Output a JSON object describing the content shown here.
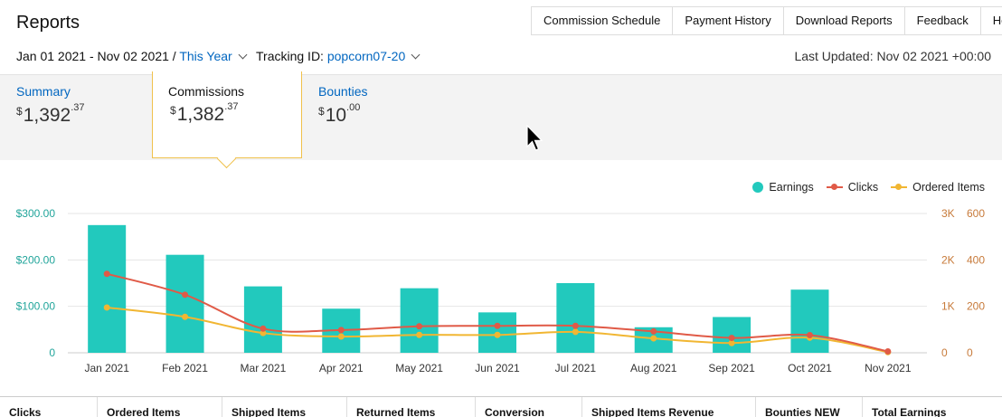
{
  "header": {
    "title": "Reports",
    "nav": [
      "Commission Schedule",
      "Payment History",
      "Download Reports",
      "Feedback",
      "Help"
    ]
  },
  "subbar": {
    "date_range": "Jan 01 2021 - Nov 02 2021",
    "separator": "/",
    "period": "This Year",
    "tracking_label": "Tracking ID:",
    "tracking_id": "popcorn07-20",
    "last_updated": "Last Updated: Nov 02 2021 +00:00"
  },
  "tabs": [
    {
      "label": "Summary",
      "currency": "$",
      "whole": "1,392",
      "cents": ".37"
    },
    {
      "label": "Commissions",
      "currency": "$",
      "whole": "1,382",
      "cents": ".37"
    },
    {
      "label": "Bounties",
      "currency": "$",
      "whole": "10",
      "cents": ".00"
    }
  ],
  "colors": {
    "earnings": "#22c9bd",
    "clicks": "#e05a47",
    "ordered": "#f1b632",
    "right_axis": "#c77a3a",
    "left_axis": "#22a59b",
    "accent": "#0066c0"
  },
  "chart_data": {
    "type": "bar",
    "categories": [
      "Jan 2021",
      "Feb 2021",
      "Mar 2021",
      "Apr 2021",
      "May 2021",
      "Jun 2021",
      "Jul 2021",
      "Aug 2021",
      "Sep 2021",
      "Oct 2021",
      "Nov 2021"
    ],
    "series": [
      {
        "name": "Earnings",
        "type": "bar",
        "axis": "left",
        "values": [
          275,
          211,
          143,
          95,
          139,
          87,
          150,
          55,
          77,
          136,
          0
        ]
      },
      {
        "name": "Clicks",
        "type": "line",
        "axis": "right-outer",
        "values": [
          1700,
          1250,
          520,
          490,
          570,
          580,
          580,
          460,
          320,
          380,
          30
        ]
      },
      {
        "name": "Ordered Items",
        "type": "line",
        "axis": "right-inner",
        "values": [
          195,
          155,
          85,
          70,
          77,
          77,
          90,
          62,
          42,
          65,
          3
        ]
      }
    ],
    "y_left": {
      "ticks": [
        "$300.00",
        "$200.00",
        "$100.00",
        "0"
      ],
      "range": [
        0,
        300
      ]
    },
    "y_right_outer": {
      "ticks": [
        "3K",
        "2K",
        "1K",
        "0"
      ],
      "range": [
        0,
        3000
      ]
    },
    "y_right_inner": {
      "ticks": [
        "600",
        "400",
        "200",
        "0"
      ],
      "range": [
        0,
        600
      ]
    },
    "legend": [
      "Earnings",
      "Clicks",
      "Ordered Items"
    ],
    "legend_position": "top-right",
    "grid": true
  },
  "bottom_columns": [
    "Clicks",
    "Ordered Items",
    "Shipped Items",
    "Returned Items",
    "Conversion",
    "Shipped Items Revenue",
    "Bounties NEW",
    "Total Earnings"
  ]
}
